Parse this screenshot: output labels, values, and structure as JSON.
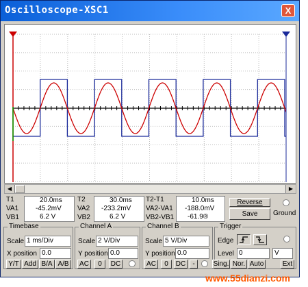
{
  "window": {
    "title": "Oscilloscope-XSC1",
    "close": "X"
  },
  "cursors": {
    "t1": {
      "label": "T1",
      "time": "20.0ms",
      "va_label": "VA1",
      "va": "-45.2mV",
      "vb_label": "VB1",
      "vb": "6.2 V"
    },
    "t2": {
      "label": "T2",
      "time": "30.0ms",
      "va_label": "VA2",
      "va": "-233.2mV",
      "vb_label": "VB2",
      "vb": "6.2 V"
    },
    "diff": {
      "label": "T2-T1",
      "time": "10.0ms",
      "va_label": "VA2-VA1",
      "va": "-188.0mV",
      "vb_label": "VB2-VB1",
      "vb": "-61.9®"
    }
  },
  "buttons": {
    "reverse": "Reverse",
    "save": "Save",
    "ground": "Ground"
  },
  "timebase": {
    "title": "Timebase",
    "scale_label": "Scale",
    "scale": "1 ms/Div",
    "xpos_label": "X position",
    "xpos": "0.0",
    "modes": [
      "Y/T",
      "Add",
      "B/A",
      "A/B"
    ]
  },
  "channel_a": {
    "title": "Channel A",
    "scale_label": "Scale",
    "scale": "2 V/Div",
    "ypos_label": "Y position",
    "ypos": "0.0",
    "coupling": [
      "AC",
      "0",
      "DC"
    ]
  },
  "channel_b": {
    "title": "Channel B",
    "scale_label": "Scale",
    "scale": "5 V/Div",
    "ypos_label": "Y position",
    "ypos": "0.0",
    "coupling": [
      "AC",
      "0",
      "DC",
      "-"
    ]
  },
  "trigger": {
    "title": "Trigger",
    "edge_label": "Edge",
    "level_label": "Level",
    "level": "0",
    "unit": "V",
    "modes": [
      "Sing.",
      "Nor.",
      "Auto",
      "Ext"
    ]
  },
  "watermark": "www.55dianzi.com",
  "colors": {
    "channel_a": "#cc0000",
    "channel_b": "#1a2a9a",
    "grid": "#bdbdbd",
    "cursor1": "#cc0000",
    "cursor2": "#1a2a9a"
  }
}
